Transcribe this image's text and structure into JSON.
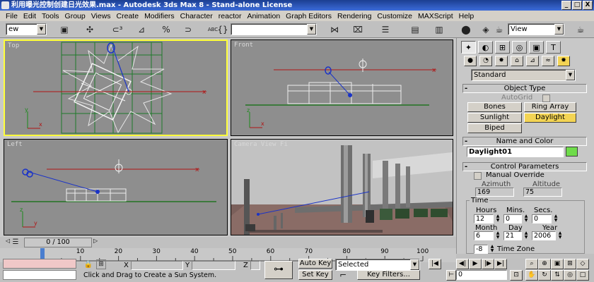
{
  "window": {
    "title": "利用曝光控制创建日光效果.max - Autodesk 3ds Max 8 - Stand-alone License",
    "minimize": "_",
    "maximize": "□",
    "close": "X"
  },
  "menu": [
    "File",
    "Edit",
    "Tools",
    "Group",
    "Views",
    "Create",
    "Modifiers",
    "Character",
    "reactor",
    "Animation",
    "Graph Editors",
    "Rendering",
    "Customize",
    "MAXScript",
    "Help"
  ],
  "toolbar": {
    "undo_dropdown": "ew",
    "selection_set": "",
    "view_dropdown": "View"
  },
  "viewports": {
    "top_label": "Top",
    "front_label": "Front",
    "left_label": "Left",
    "camera_label": "Camera View Fi"
  },
  "command_panel": {
    "category_dropdown": "Standard",
    "object_type": {
      "header": "Object Type",
      "autogrid": "AutoGrid",
      "buttons": [
        "Bones",
        "Ring Array",
        "Sunlight",
        "Daylight",
        "Biped"
      ]
    },
    "name_color": {
      "header": "Name and Color",
      "name_value": "Daylight01",
      "color": "#6fdc4a"
    },
    "control": {
      "header": "Control Parameters",
      "manual_override": "Manual Override",
      "azimuth_label": "Azimuth",
      "altitude_label": "Altitude",
      "azimuth": "169",
      "altitude": "75",
      "time_label": "Time",
      "hours_label": "Hours",
      "mins_label": "Mins.",
      "secs_label": "Secs.",
      "hours": "12",
      "mins": "0",
      "secs": "0",
      "month_label": "Month",
      "day_label": "Day",
      "year_label": "Year",
      "month": "6",
      "day": "21",
      "year": "2006",
      "timezone_value": "-8",
      "timezone_label": "Time Zone"
    }
  },
  "timeline": {
    "slider": "0 / 100",
    "ticks": [
      "0",
      "10",
      "20",
      "30",
      "40",
      "50",
      "60",
      "70",
      "80",
      "90",
      "100"
    ]
  },
  "status": {
    "x_label": "X",
    "y_label": "Y",
    "z_label": "Z",
    "prompt": "Click and Drag to Create a Sun System.",
    "auto_key": "Auto Key",
    "set_key": "Set Key",
    "selected_dropdown": "Selected",
    "key_filters": "Key Filters...",
    "frame": "0"
  }
}
